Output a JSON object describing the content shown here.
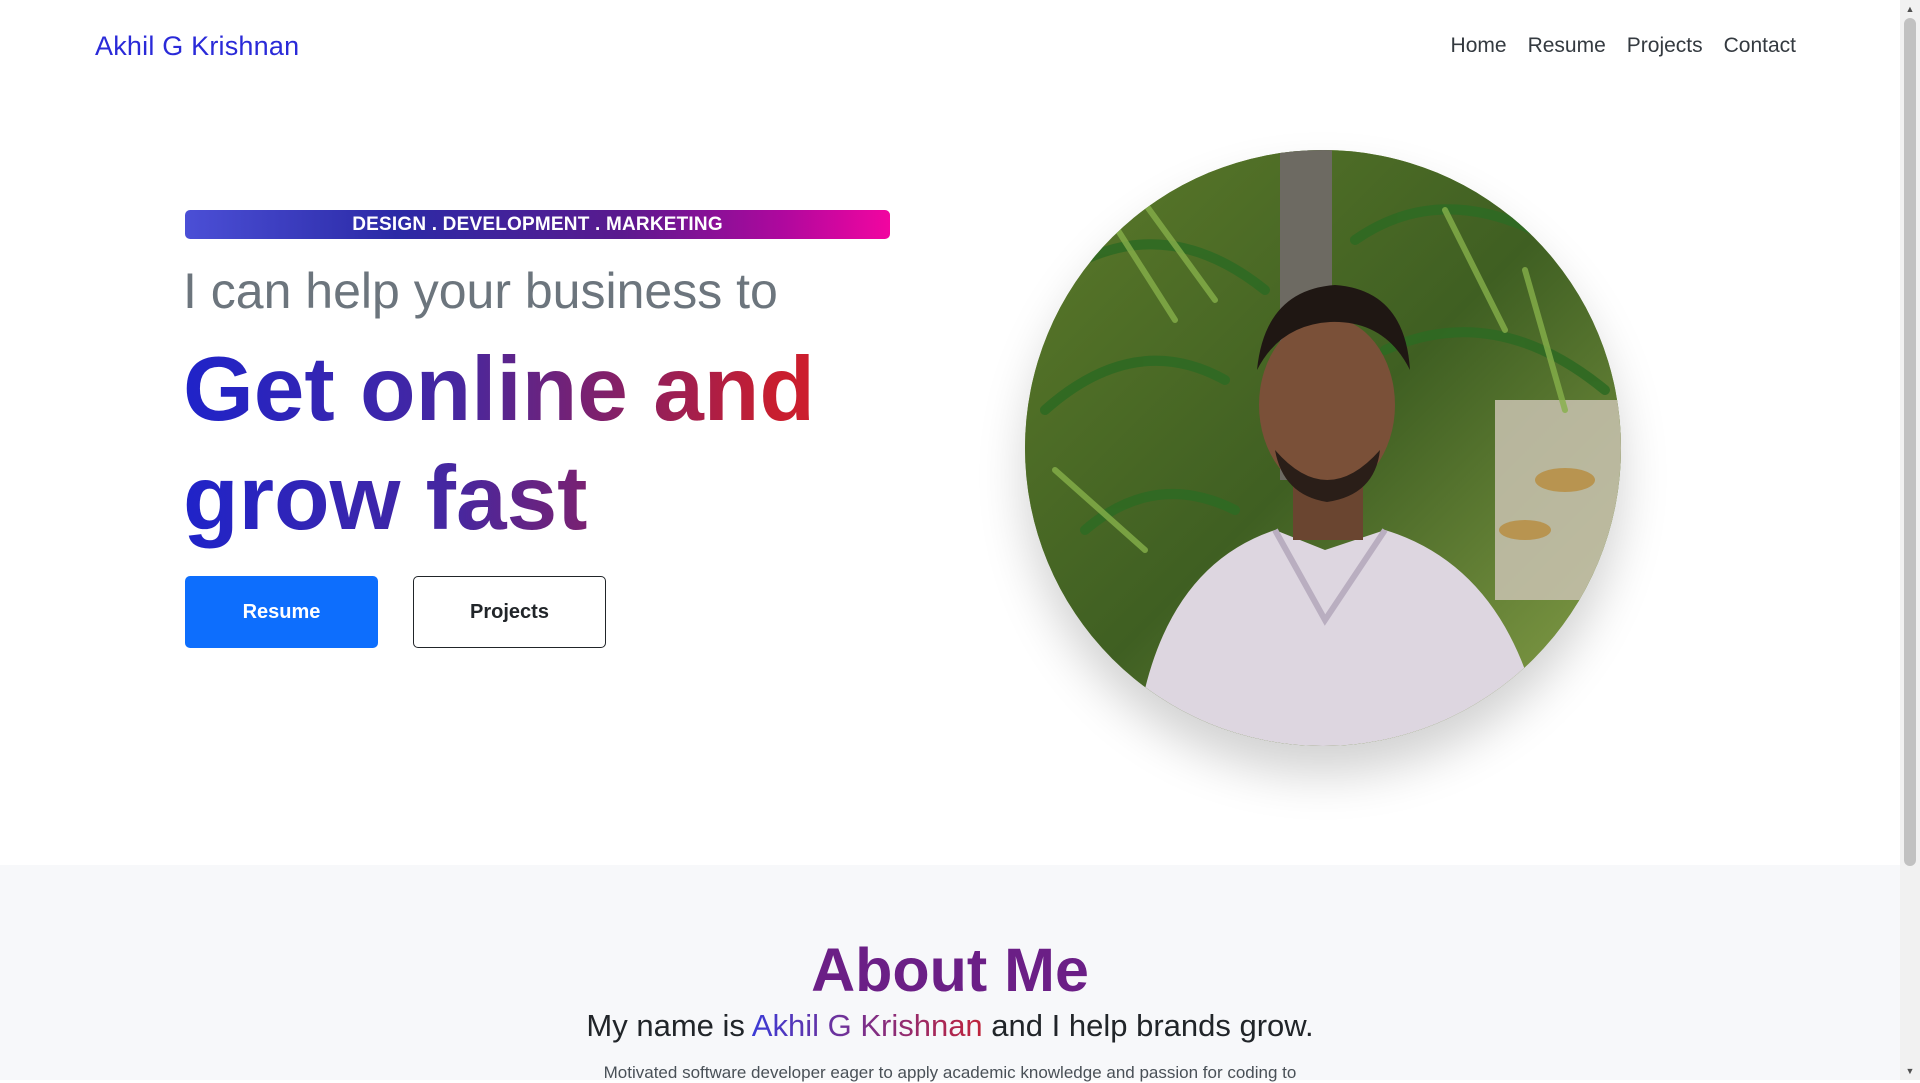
{
  "nav": {
    "brand": "Akhil G Krishnan",
    "links": [
      "Home",
      "Resume",
      "Projects",
      "Contact"
    ]
  },
  "hero": {
    "tagline": "DESIGN . DEVELOPMENT . MARKETING",
    "subtitle": "I can help your business to",
    "title": "Get online and grow fast",
    "buttons": {
      "primary": "Resume",
      "secondary": "Projects"
    }
  },
  "about": {
    "title": "About Me",
    "intro_before": "My name is ",
    "intro_name": "Akhil G Krishnan",
    "intro_after": " and I help brands grow.",
    "description": "Motivated software developer eager to apply academic knowledge and passion for coding to"
  },
  "colors": {
    "brand": "#2a2ad8",
    "primary_button": "#0d6efd",
    "about_title": "#6b1f86"
  },
  "icons": {
    "scroll_up": "scroll-up-arrow-icon",
    "scroll_down": "scroll-down-arrow-icon"
  }
}
